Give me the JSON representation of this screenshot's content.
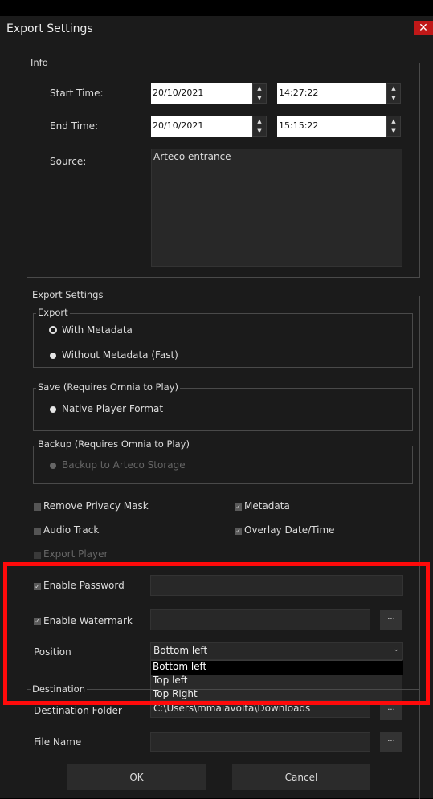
{
  "window": {
    "title": "Export Settings",
    "close_icon": "close-icon"
  },
  "info": {
    "legend": "Info",
    "start_time_label": "Start Time:",
    "start_date": "20/10/2021",
    "start_time": "14:27:22",
    "end_time_label": "End Time:",
    "end_date": "20/10/2021",
    "end_time": "15:15:22",
    "source_label": "Source:",
    "source_value": "Arteco entrance"
  },
  "export_settings": {
    "legend": "Export Settings",
    "export_group": {
      "legend": "Export",
      "options": [
        "With Metadata",
        "Without Metadata (Fast)"
      ],
      "selected": "With Metadata"
    },
    "save_group": {
      "legend": "Save (Requires Omnia to Play)",
      "option": "Native Player Format"
    },
    "backup_group": {
      "legend": "Backup (Requires Omnia to Play)",
      "option": "Backup to Arteco Storage"
    },
    "checks": {
      "remove_privacy_mask": "Remove Privacy Mask",
      "metadata": "Metadata",
      "audio_track": "Audio Track",
      "overlay_datetime": "Overlay Date/Time",
      "export_player": "Export Player"
    },
    "enable_password": "Enable Password",
    "enable_watermark": "Enable Watermark",
    "watermark_browse": "...",
    "position_label": "Position",
    "position_selected": "Bottom left",
    "position_options": [
      "Bottom left",
      "Top left",
      "Top Right"
    ]
  },
  "destination": {
    "legend": "Destination",
    "folder_label": "Destination Folder",
    "folder_value": "C:\\Users\\mmaiavolta\\Downloads",
    "folder_browse": "...",
    "file_name_label": "File Name",
    "file_name_browse": "..."
  },
  "buttons": {
    "ok": "OK",
    "cancel": "Cancel"
  }
}
